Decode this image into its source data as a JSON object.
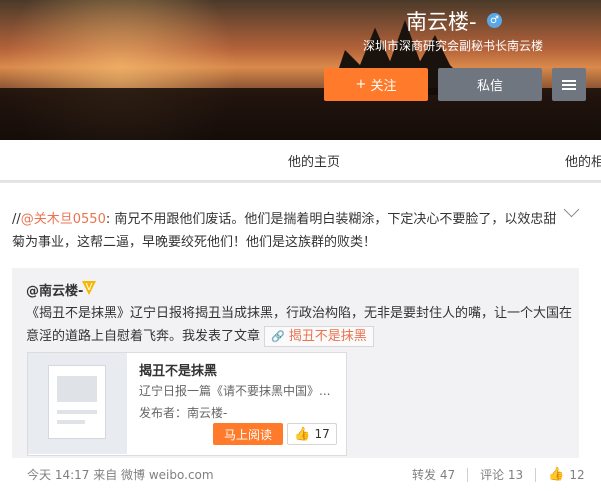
{
  "profile": {
    "name": "南云楼-",
    "gender_icon": "male",
    "subtitle": "深圳市深商研究会副秘书长南云楼",
    "follow_label": "关注",
    "message_label": "私信"
  },
  "tabs": [
    "他的主页",
    "他的相"
  ],
  "post": {
    "prefix": "//",
    "mention": "@关木旦0550",
    "text": ": 南兄不用跟他们废话。他们是揣着明白装糊涂，下定决心不要脸了，以效忠甜菊为事业，这帮二逼，早晚要绞死他们！他们是这族群的败类！",
    "time": "今天 14:17",
    "source": "来自 微博 weibo.com",
    "repost_label": "转发 47",
    "comment_label": "评论 13",
    "likes": "12"
  },
  "quoted": {
    "author": "@南云楼-",
    "text": "《揭丑不是抹黑》辽宁日报将揭丑当成抹黑，行政治构陷，无非是要封住人的嘴，让一个大国在意淫的道路上自慰着飞奔。我发表了文章",
    "tag_label": "揭丑不是抹黑",
    "article": {
      "title": "揭丑不是抹黑",
      "desc": "辽宁日报一篇《请不要抹黑中国》...",
      "publisher": "发布者：南云楼-",
      "read_label": "马上阅读",
      "likes": "17"
    }
  },
  "colors": {
    "accent": "#ff7a2a",
    "link": "#eb7350",
    "button_gray": "#6f7680"
  }
}
